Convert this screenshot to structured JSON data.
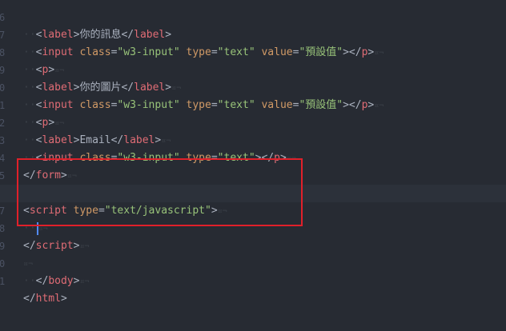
{
  "gutter": {
    "line_numbers": [
      "6",
      "7",
      "8",
      "9",
      "0",
      "1",
      "2",
      "3",
      "4",
      "5",
      "6",
      "7",
      "8",
      "9",
      "0",
      "1"
    ]
  },
  "code": {
    "line0_label_text": "你的訊息",
    "value_default": "預設值",
    "label_picture": "你的圖片",
    "label_email": "Email",
    "class_value": "w3-input",
    "type_text": "text",
    "type_js": "text/javascript"
  },
  "highlight": {
    "color": "#e0202a"
  }
}
